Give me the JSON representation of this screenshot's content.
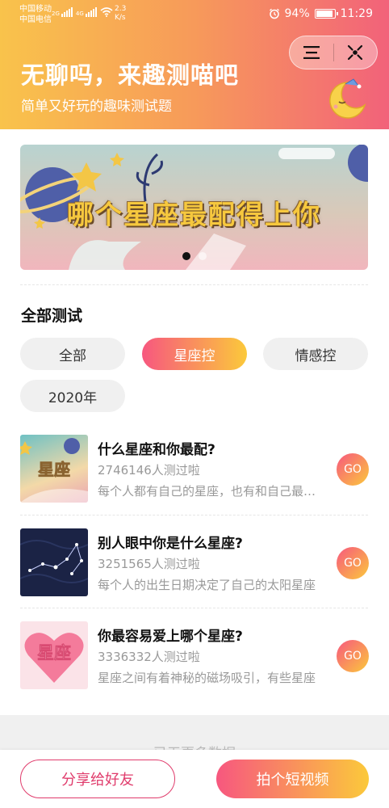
{
  "status_bar": {
    "carrier1": "中国移动",
    "carrier2": "中国电信",
    "sig1_tag": "2G",
    "sig2_tag": "4G",
    "speed_value": "2.3",
    "speed_unit": "K/s",
    "battery": "94%",
    "battery_level": 0.94,
    "time": "11:29"
  },
  "header": {
    "title": "无聊吗，来趣测喵吧",
    "subtitle": "简单又好玩的趣味测试题",
    "menu_icon": "menu-icon",
    "close_icon": "target-close-icon"
  },
  "banner": {
    "text": "哪个星座最配得上你",
    "dots": 2,
    "active_dot": 0
  },
  "section": {
    "title": "全部测试"
  },
  "chips": [
    {
      "label": "全部",
      "active": false
    },
    {
      "label": "星座控",
      "active": true
    },
    {
      "label": "情感控",
      "active": false
    },
    {
      "label": "2020年",
      "active": false
    }
  ],
  "items": [
    {
      "title": "什么星座和你最配?",
      "count": "2746146人测过啦",
      "desc": "每个人都有自己的星座，也有和自己最配的星座",
      "go": "GO",
      "thumb_text": "星座"
    },
    {
      "title": "别人眼中你是什么星座?",
      "count": "3251565人测过啦",
      "desc": "每个人的出生日期决定了自己的太阳星座",
      "go": "GO",
      "thumb_text": ""
    },
    {
      "title": "你最容易爱上哪个星座?",
      "count": "3336332人测过啦",
      "desc": "星座之间有着神秘的磁场吸引，有些星座",
      "go": "GO",
      "thumb_text": "星座"
    }
  ],
  "footer": {
    "more_text": "已无更多数据",
    "share_label": "分享给好友",
    "video_label": "拍个短视频"
  },
  "colors": {
    "header_start": "#f9c34b",
    "header_end": "#f2627a",
    "accent_pink": "#f7577f",
    "accent_yellow": "#fbc93b",
    "share_border": "#e03c6c"
  }
}
